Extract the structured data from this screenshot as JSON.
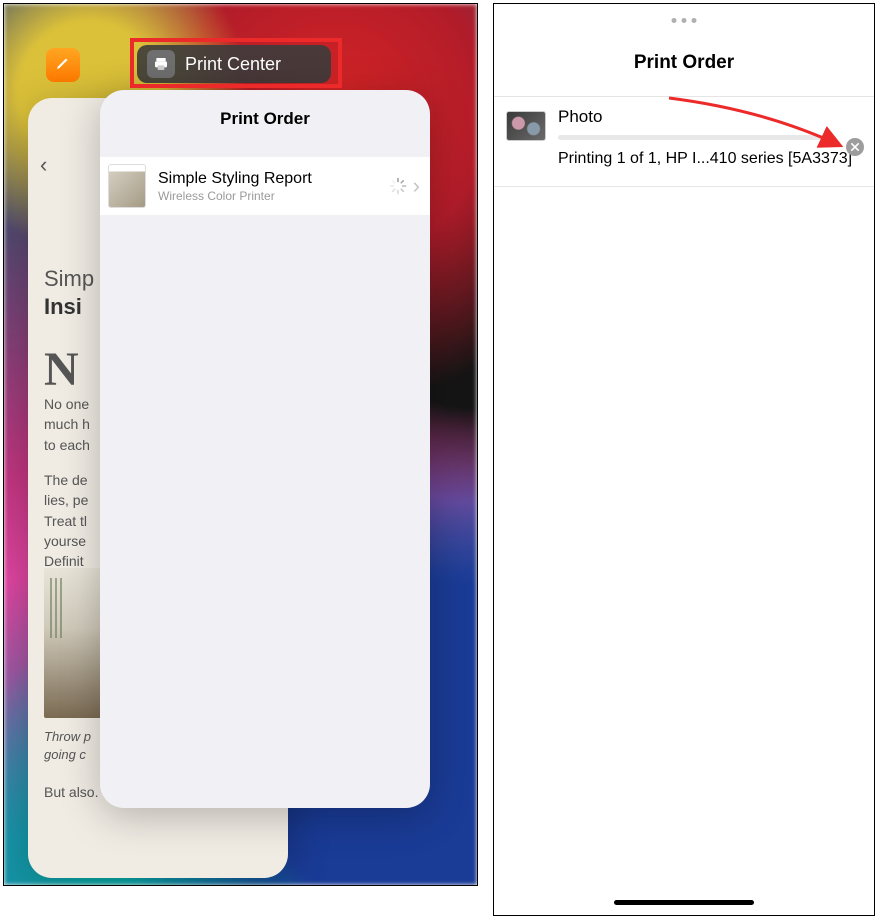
{
  "left": {
    "pills": {
      "print_center_label": "Print Center"
    },
    "pages_card": {
      "heading_line1": "Simp",
      "heading_line2": "Insi",
      "dropcap": "N",
      "para1": "No one\nmuch h\nto each",
      "para2": "The de\nlies, pe\nTreat tl\nyourse\nDefinit",
      "caption": "Throw p\ngoing c",
      "after": "But also."
    },
    "print_card": {
      "title": "Print Order",
      "job_title": "Simple Styling Report",
      "job_sub": "Wireless Color Printer"
    }
  },
  "right": {
    "title": "Print Order",
    "job_name": "Photo",
    "status": "Printing 1 of 1, HP I...410 series [5A3373]"
  }
}
